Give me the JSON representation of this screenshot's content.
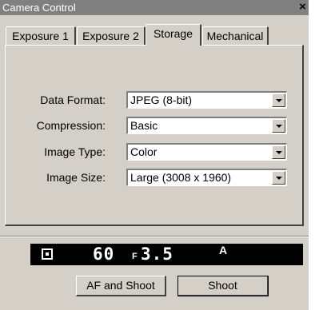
{
  "window": {
    "title": "Camera Control",
    "close_glyph": "×"
  },
  "tabs": [
    {
      "label": "Exposure 1",
      "active": false
    },
    {
      "label": "Exposure 2",
      "active": false
    },
    {
      "label": "Storage",
      "active": true
    },
    {
      "label": "Mechanical",
      "active": false
    }
  ],
  "storage": {
    "data_format": {
      "label": "Data Format:",
      "value": "JPEG (8-bit)"
    },
    "compression": {
      "label": "Compression:",
      "value": "Basic"
    },
    "image_type": {
      "label": "Image Type:",
      "value": "Color"
    },
    "image_size": {
      "label": "Image Size:",
      "value": "Large (3008 x 1960)"
    }
  },
  "lcd": {
    "meter_icon": "matrix-metering-icon",
    "shutter": "60",
    "f_prefix": "F",
    "aperture": "3.5",
    "mode": "A"
  },
  "buttons": {
    "af_shoot": "AF and Shoot",
    "shoot": "Shoot"
  },
  "colors": {
    "face": "#d4d0c8",
    "titlebar": "#808080",
    "lcd_bg": "#000000",
    "lcd_fg": "#ffffff"
  }
}
